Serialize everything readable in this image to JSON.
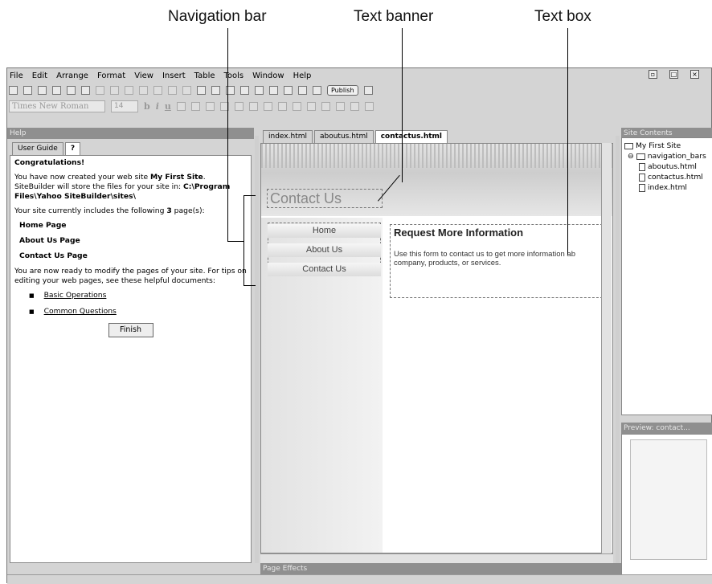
{
  "callouts": {
    "navigation_bar": "Navigation bar",
    "text_banner": "Text banner",
    "text_box": "Text box"
  },
  "menu": [
    "File",
    "Edit",
    "Arrange",
    "Format",
    "View",
    "Insert",
    "Table",
    "Tools",
    "Window",
    "Help"
  ],
  "toolbar": {
    "publish_label": "Publish"
  },
  "format_bar": {
    "font": "Times New Roman",
    "size": "14",
    "bold": "b",
    "italic": "i",
    "underline": "u"
  },
  "help_panel": {
    "title": "Help",
    "tab_user_guide": "User Guide",
    "tab_icon_label": "?",
    "heading": "Congratulations!",
    "para1_a": "You have now created your web site ",
    "site_name": "My First Site",
    "para1_b": ". SiteBuilder will store the files for your site in: ",
    "path": "C:\\Program Files\\Yahoo SiteBuilder\\sites\\",
    "para2_a": "Your site currently includes the following ",
    "page_count": "3",
    "para2_b": " page(s):",
    "pages": [
      "Home Page",
      "About Us Page",
      "Contact Us Page"
    ],
    "para3": "You are now ready to modify the pages of your site. For tips on editing your web pages, see these helpful documents:",
    "links": [
      "Basic Operations",
      "Common Questions"
    ],
    "finish_label": "Finish"
  },
  "editor": {
    "tabs": [
      "index.html",
      "aboutus.html",
      "contactus.html"
    ],
    "active_tab": "contactus.html",
    "banner_text": "Contact Us",
    "nav_items": [
      "Home",
      "About Us",
      "Contact Us"
    ],
    "textbox_heading": "Request More Information",
    "textbox_body_line1": "Use this form to contact us to get more information ab",
    "textbox_body_line2": "company, products, or services."
  },
  "page_effects_label": "Page Effects",
  "site_contents": {
    "title": "Site Contents",
    "root": "My First Site",
    "folder": "navigation_bars",
    "files": [
      "aboutus.html",
      "contactus.html",
      "index.html"
    ]
  },
  "preview": {
    "title": "Preview: contact..."
  }
}
